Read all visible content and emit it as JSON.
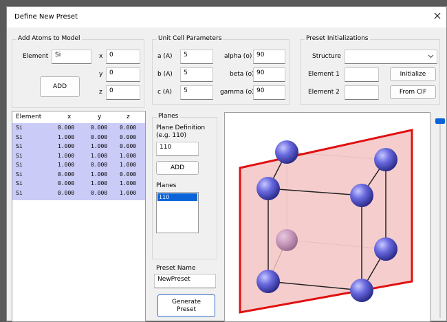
{
  "window": {
    "title": "Define New Preset"
  },
  "add_atoms": {
    "title": "Add Atoms to Model",
    "element_label": "Element",
    "element_value": "Si",
    "x_label": "x",
    "x_value": "0",
    "y_label": "y",
    "y_value": "0",
    "z_label": "z",
    "z_value": "0",
    "add_button": "ADD"
  },
  "unit_cell": {
    "title": "Unit Cell Parameters",
    "a_label": "a (A)",
    "a_value": "5",
    "b_label": "b (A)",
    "b_value": "5",
    "c_label": "c (A)",
    "c_value": "5",
    "alpha_label": "alpha (o)",
    "alpha_value": "90",
    "beta_label": "beta (o)",
    "beta_value": "90",
    "gamma_label": "gamma (o)",
    "gamma_value": "90"
  },
  "preset_init": {
    "title": "Preset Initializations",
    "structure_label": "Structure",
    "structure_value": "",
    "element1_label": "Element 1",
    "element1_value": "",
    "element2_label": "Element 2",
    "element2_value": "",
    "initialize_button": "Initialize",
    "from_cif_button": "From CIF"
  },
  "atom_table": {
    "headers": [
      "Element",
      "x",
      "y",
      "z"
    ],
    "rows": [
      [
        "Si",
        "0.000",
        "0.000",
        "0.000"
      ],
      [
        "Si",
        "1.000",
        "0.000",
        "0.000"
      ],
      [
        "Si",
        "1.000",
        "1.000",
        "0.000"
      ],
      [
        "Si",
        "1.000",
        "1.000",
        "1.000"
      ],
      [
        "Si",
        "1.000",
        "0.000",
        "1.000"
      ],
      [
        "Si",
        "0.000",
        "1.000",
        "0.000"
      ],
      [
        "Si",
        "0.000",
        "1.000",
        "1.000"
      ],
      [
        "Si",
        "0.000",
        "0.000",
        "1.000"
      ]
    ]
  },
  "planes": {
    "title": "Planes",
    "definition_label": "Plane Definition\n(e.g. 110)",
    "definition_value": "110",
    "add_button": "ADD",
    "list_label": "Planes",
    "items": [
      "110"
    ]
  },
  "preset_name": {
    "label": "Preset Name",
    "value": "NewPreset",
    "generate_button": "Generate\nPreset"
  },
  "colors": {
    "atom": "#5a5ad6",
    "plane_fill": "#f4c4c4",
    "plane_border": "#e01010",
    "selection": "#cbcbf7",
    "list_selection": "#0a64d8"
  }
}
